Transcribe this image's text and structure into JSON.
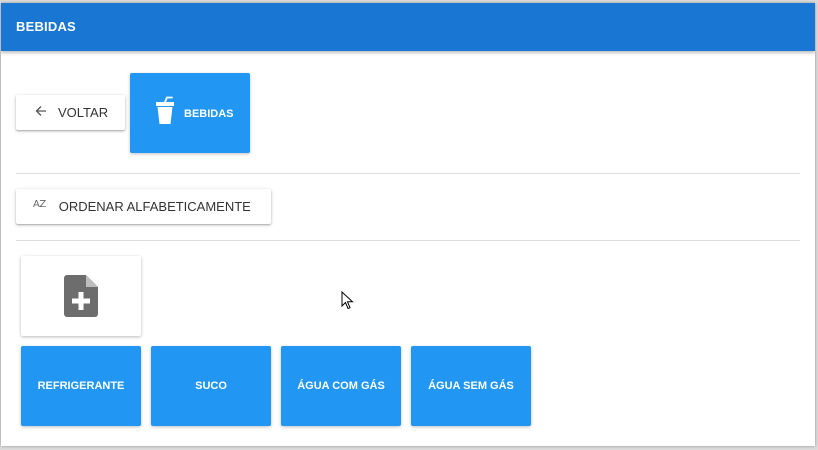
{
  "header": {
    "title": "BEBIDAS"
  },
  "toolbar": {
    "back_label": "VOLTAR",
    "back_icon": "arrow-left-icon",
    "category_label": "BEBIDAS",
    "category_icon": "cup-icon",
    "sort_label": "ORDENAR ALFABETICAMENTE",
    "sort_icon_text": "AZ"
  },
  "add_tile": {
    "icon": "file-plus-icon"
  },
  "products": [
    {
      "label": "REFRIGERANTE"
    },
    {
      "label": "SUCO"
    },
    {
      "label": "ÁGUA COM GÁS"
    },
    {
      "label": "ÁGUA SEM GÁS"
    }
  ],
  "colors": {
    "header_bg": "#1976d2",
    "tile_bg": "#2196f3",
    "icon_gray": "#6d6d6d"
  }
}
